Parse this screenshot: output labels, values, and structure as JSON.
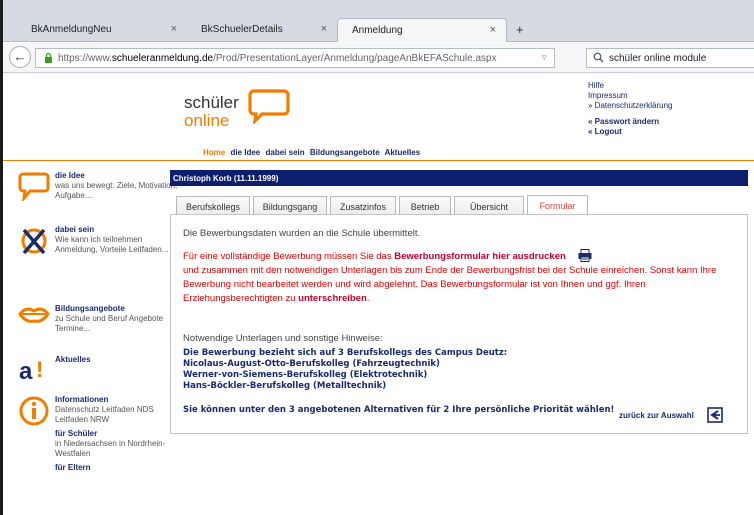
{
  "browser": {
    "tabs": [
      {
        "title": "BkAnmeldungNeu"
      },
      {
        "title": "BkSchuelerDetails"
      },
      {
        "title": "Anmeldung"
      }
    ],
    "new_tab": "+",
    "url_prefix": "https://www.",
    "url_domain": "schueleranmeldung.de",
    "url_path": "/Prod/PresentationLayer/Anmeldung/pageAnBkEFASchule.aspx",
    "search_value": "schüler online module"
  },
  "header": {
    "logo_line1": "schüler",
    "logo_line2": "online",
    "links": {
      "hilfe": "Hilfe",
      "impressum": "Impressum",
      "datenschutz": "» Datenschutzerklärung",
      "passwort": "« Passwort ändern",
      "logout": "« Logout"
    },
    "nav": [
      "Home",
      "die Idee",
      "dabei sein",
      "Bildungsangebote",
      "Aktuelles"
    ]
  },
  "sidebar": {
    "idee": {
      "title": "die Idee",
      "text": "was uns bewegt: Ziele, Motivation, Aufgabe..."
    },
    "dabei": {
      "title": "dabei sein",
      "text": "Wie kann ich teilnehmen Anmeldung, Vorteile Leitfaden..."
    },
    "bildung": {
      "title": "Bildungsangebote",
      "text": "zu Schule und Beruf Angebote Termine..."
    },
    "aktuelles": {
      "title": "Aktuelles"
    },
    "info": {
      "title": "Informationen",
      "text": "Datenschutz Leitfaden NDS Leitfaden NRW",
      "schueler_title": "für Schüler",
      "schueler_text": "in Niedersachsen in Nordrhein-Westfalen",
      "eltern_title": "für Eltern"
    }
  },
  "content": {
    "student": "Christoph Korb (11.11.1999)",
    "tabs": [
      "Berufskollegs",
      "Bildungsgang",
      "Zusatzinfos",
      "Betrieb",
      "Übersicht",
      "Formular"
    ],
    "active_tab": "Formular",
    "msg_submitted": "Die Bewerbungsdaten wurden an die Schule übermittelt.",
    "red_1": "Für eine vollständige Bewerbung müssen Sie das ",
    "red_bold_1": "Bewerbungsformular hier ausdrucken",
    "red_2": " und zusammen mit den notwendigen Unterlagen bis zum Ende der Bewerbungsfrist bei der Schule einreichen. Sonst kann Ihre Bewerbung nicht bearbeitet werden und wird abgelehnt. Das Bewerbungsformular ist von Ihnen und ggf. Ihren Erziehungsberechtigten zu ",
    "red_bold_2": "unterschreiben",
    "red_3": ".",
    "hinweis": "Notwendige Unterlagen und sonstige Hinweise:",
    "campus": "Die Bewerbung bezieht sich auf 3 Berufskollegs des Campus Deutz:",
    "schools": [
      "Nicolaus-August-Otto-Berufskolleg (Fahrzeugtechnik)",
      "Werner-von-Siemens-Berufskolleg (Elektrotechnik)",
      "Hans-Böckler-Berufskolleg (Metalltechnik)"
    ],
    "priority": "Sie können unter den 3 angebotenen Alternativen für 2 Ihre persönliche Priorität wählen!",
    "back_link": "zurück zur Auswahl"
  },
  "colors": {
    "accent": "#f07c00",
    "navy": "#0e1e6e",
    "error": "#e00000"
  }
}
